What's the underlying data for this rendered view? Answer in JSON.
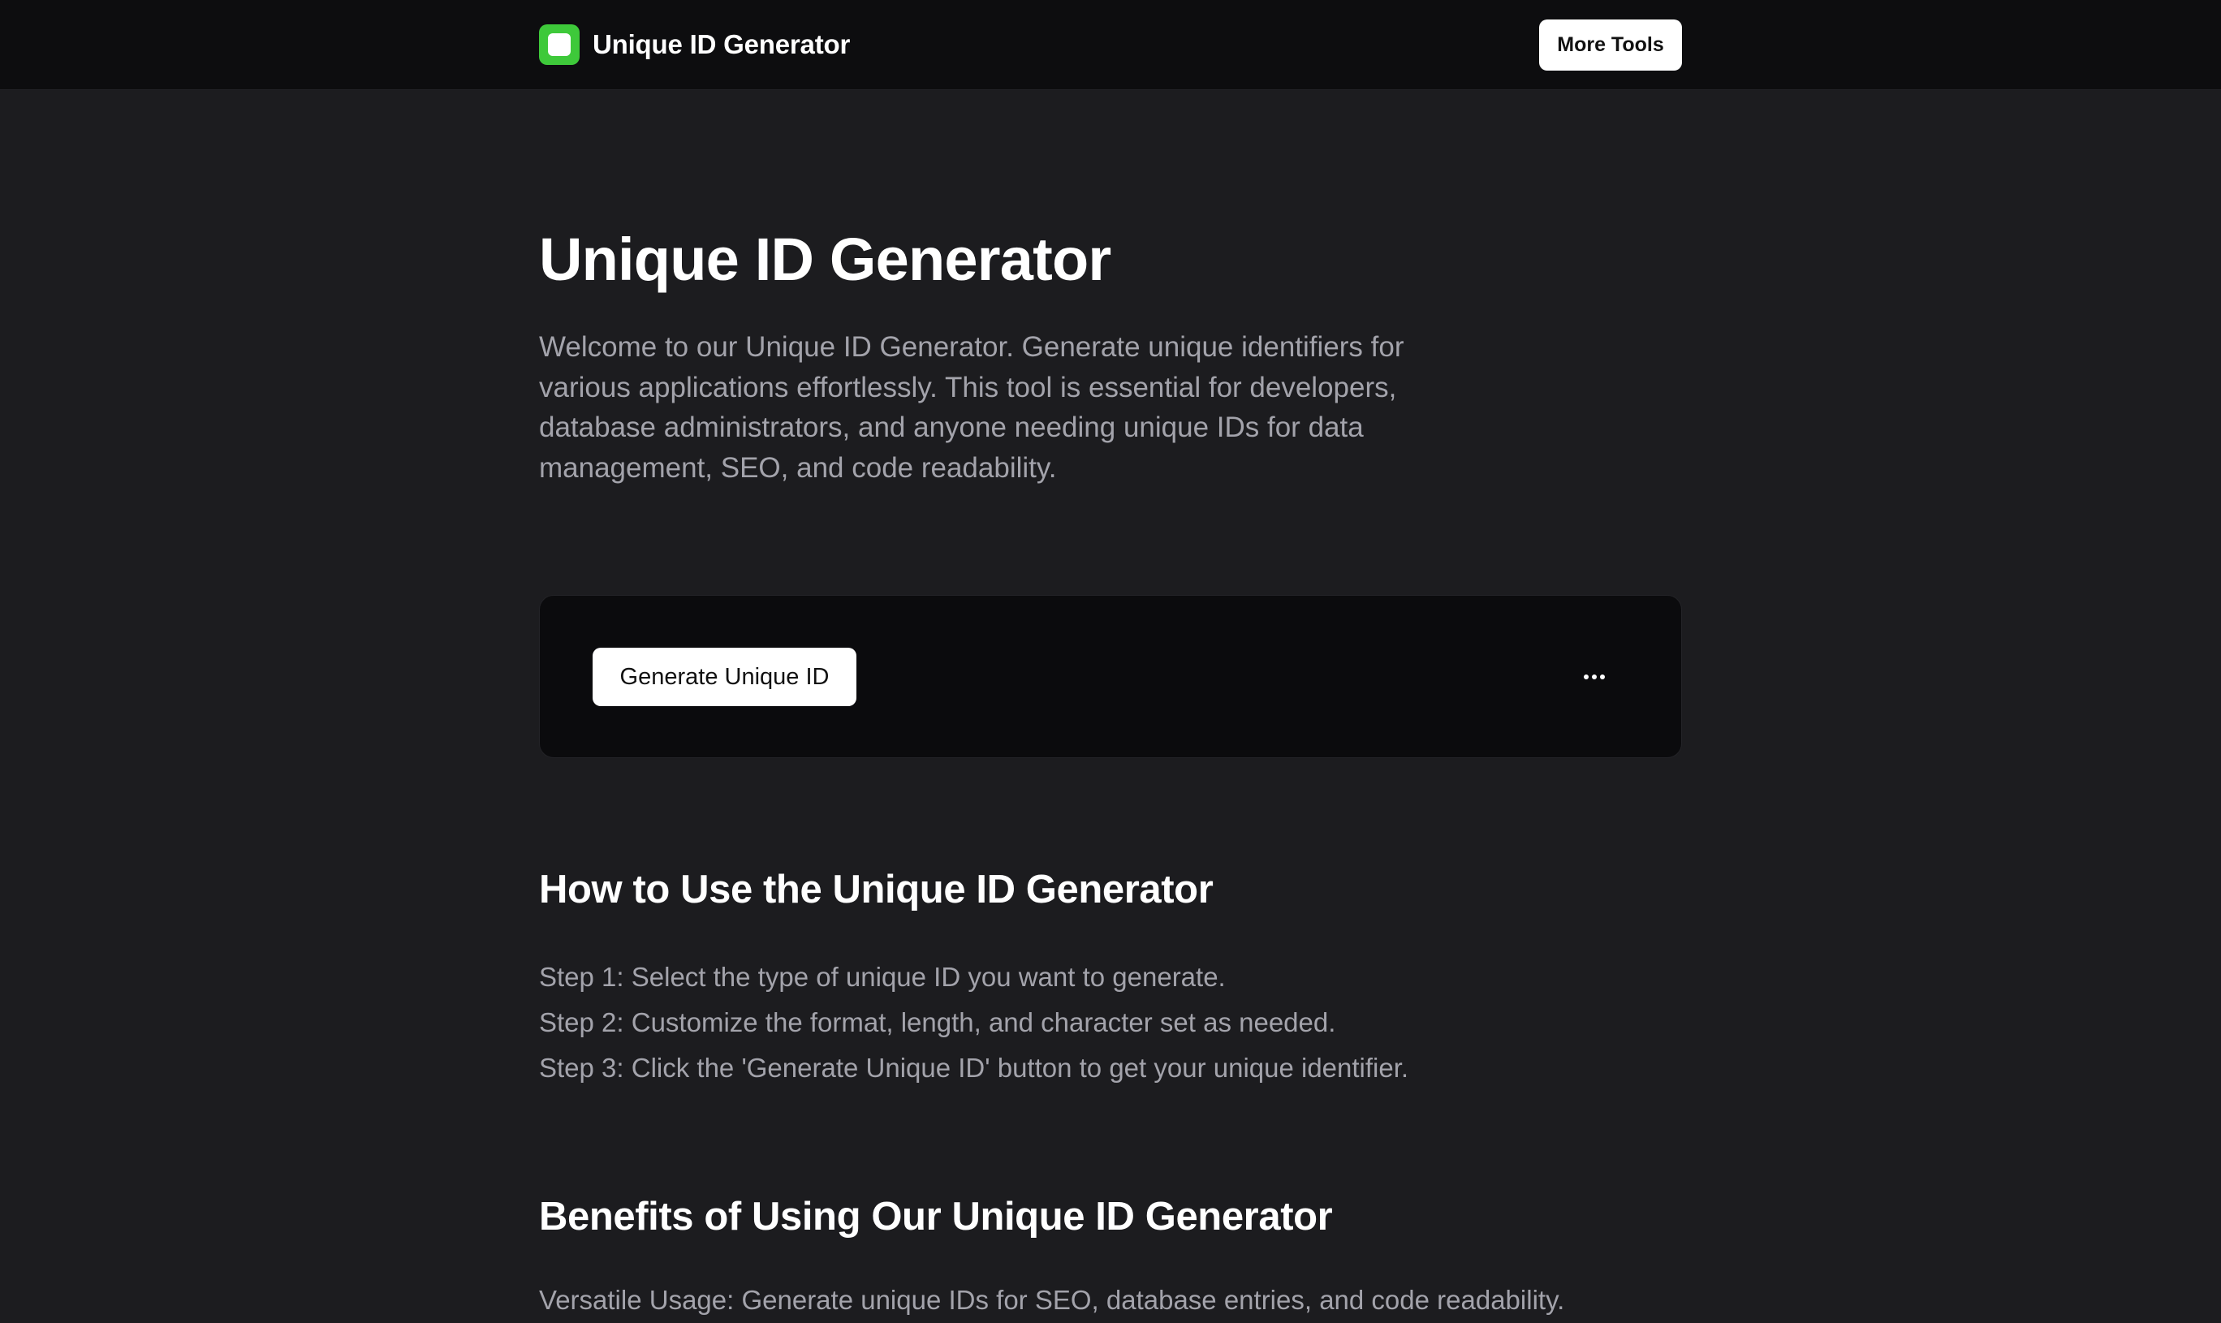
{
  "header": {
    "brand_name": "Unique ID Generator",
    "more_tools_label": "More Tools"
  },
  "hero": {
    "title": "Unique ID Generator",
    "intro": "Welcome to our Unique ID Generator. Generate unique identifiers for various applications effortlessly. This tool is essential for developers, database administrators, and anyone needing unique IDs for data management, SEO, and code readability."
  },
  "tool": {
    "generate_label": "Generate Unique ID",
    "options_icon": "more-horizontal-icon"
  },
  "how_to": {
    "heading": "How to Use the Unique ID Generator",
    "steps": [
      "Step 1: Select the type of unique ID you want to generate.",
      "Step 2: Customize the format, length, and character set as needed.",
      "Step 3: Click the 'Generate Unique ID' button to get your unique identifier."
    ]
  },
  "benefits": {
    "heading": "Benefits of Using Our Unique ID Generator",
    "items": [
      "Versatile Usage: Generate unique IDs for SEO, database entries, and code readability."
    ]
  },
  "colors": {
    "brand_green": "#3ec93a",
    "background": "#1c1c1f",
    "header_bg": "#0d0d0f",
    "card_bg": "#0b0b0d",
    "muted_text": "#a3a3ab"
  }
}
